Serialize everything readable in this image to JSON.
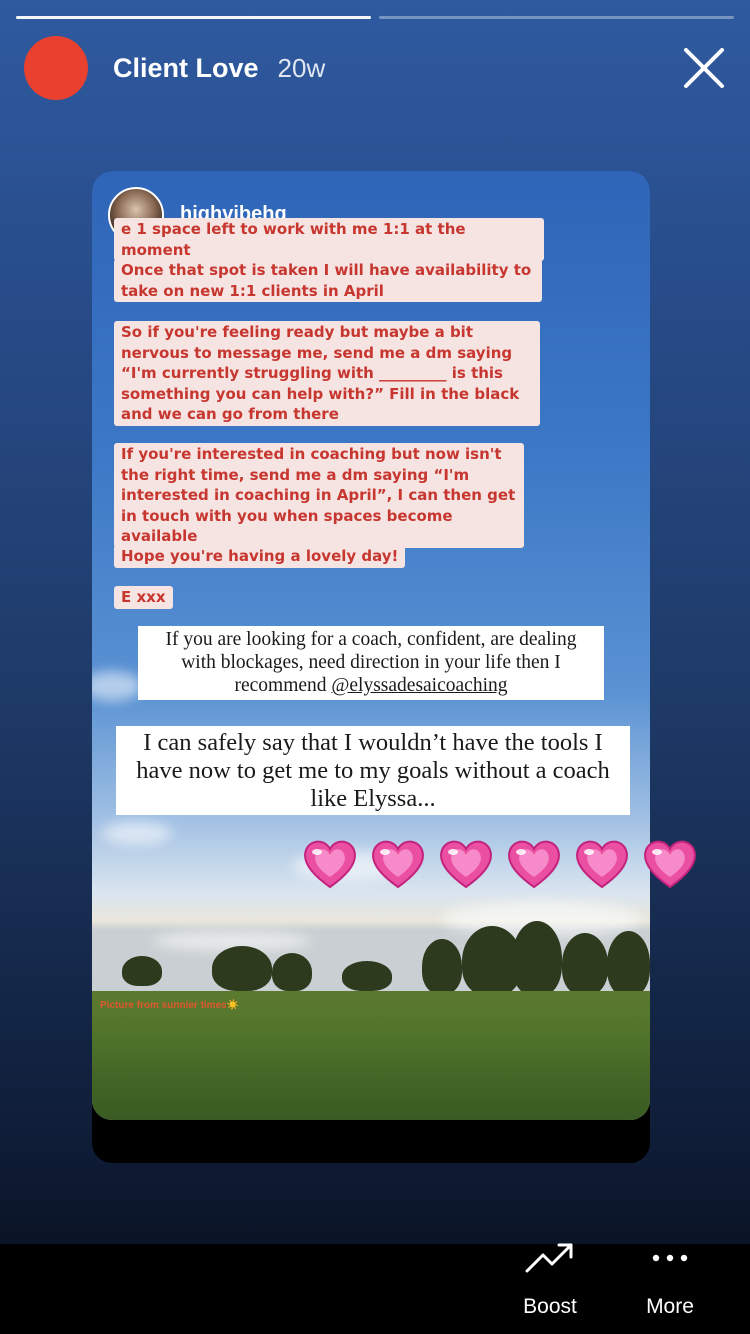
{
  "progress": {
    "total_segments": 2,
    "completed_segments": 1
  },
  "header": {
    "account_name": "Client Love",
    "post_age": "20w",
    "avatar_color": "#e8412f"
  },
  "story": {
    "original_username": "highvibehq",
    "messages": [
      "e 1 space left to work with me 1:1 at the moment",
      "Once that spot is taken I will have availability to take on new 1:1 clients in April",
      "So if you're feeling ready but maybe a bit nervous to message me, send me a dm saying “I'm currently struggling with _________ is this something you can help with?” Fill in the black and we can go from there",
      "If you're interested in coaching but now isn't the right time, send me a dm saying “I'm interested in coaching in April”, I can then get in touch with you when spaces become available",
      "Hope you're having a lovely day!",
      "E xxx"
    ],
    "quote_1_text": "If you are looking for a coach, confident, are dealing with blockages, need direction in your life then I recommend ",
    "quote_1_handle": "@elyssadesaicoaching",
    "quote_2_text": "I can safely say that I wouldn’t have the tools I have now to get me to my goals without a coach like Elyssa...",
    "photo_caption": "Picture from sunnier times☀️",
    "hearts_count": 6,
    "pill_text_color": "#c7362f",
    "pill_bg_color": "#f6e4e2"
  },
  "footer": {
    "boost_label": "Boost",
    "boost_icon": "trending-up-icon",
    "more_label": "More",
    "more_icon": "more-dots-icon"
  }
}
